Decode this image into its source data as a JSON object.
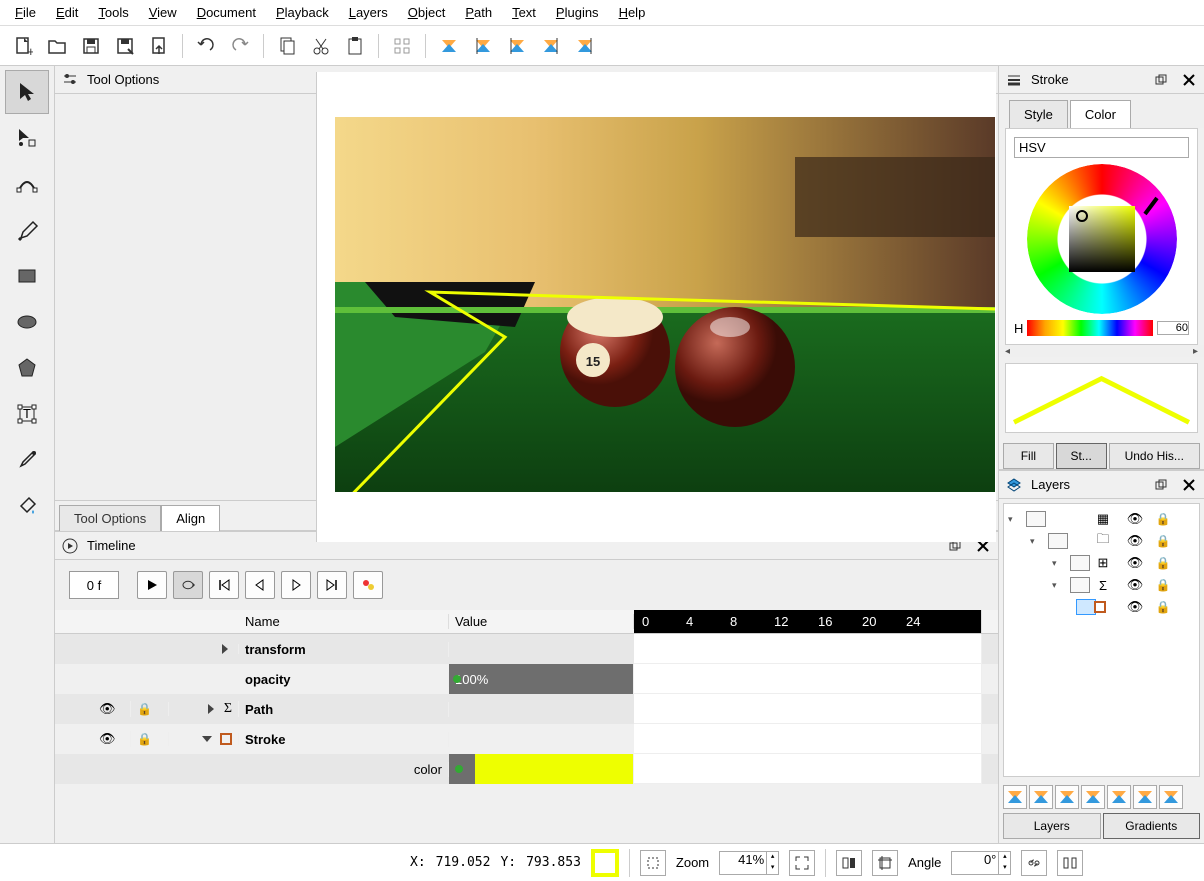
{
  "menu": [
    "File",
    "Edit",
    "Tools",
    "View",
    "Document",
    "Playback",
    "Layers",
    "Object",
    "Path",
    "Text",
    "Plugins",
    "Help"
  ],
  "toolbar_icons": [
    "new-file",
    "open-file",
    "save",
    "save-as",
    "export",
    "sep",
    "undo",
    "redo",
    "sep",
    "copy",
    "cut",
    "paste",
    "sep",
    "qr",
    "sep",
    "keyframe-a",
    "keyframe-b",
    "keyframe-c",
    "keyframe-d",
    "keyframe-e"
  ],
  "toolstrip": [
    "pointer",
    "node-edit",
    "path-tool",
    "brush",
    "rectangle",
    "ellipse",
    "polygon",
    "transform",
    "eyedropper",
    "bucket"
  ],
  "tool_options": {
    "title": "Tool Options",
    "tabs": [
      "Tool Options",
      "Align"
    ],
    "active_tab": 1
  },
  "timeline": {
    "title": "Timeline",
    "frame": "0 f",
    "columns": {
      "name": "Name",
      "value": "Value"
    },
    "ruler": [
      "0",
      "4",
      "8",
      "12",
      "16",
      "20",
      "24"
    ],
    "rows": [
      {
        "name": "transform",
        "bold": true,
        "tri": true
      },
      {
        "name": "opacity",
        "bold": true,
        "value": "100%"
      },
      {
        "name": "Path",
        "bold": true,
        "tri": true,
        "eye": true,
        "lock": true,
        "sigma": true
      },
      {
        "name": "Stroke",
        "bold": true,
        "tri_open": true,
        "eye": true,
        "lock": true,
        "box": "#c05a1e"
      },
      {
        "name": "color",
        "color": "#eeff00"
      }
    ]
  },
  "stroke": {
    "title": "Stroke",
    "tabs": [
      "Style",
      "Color"
    ],
    "active_tab": 1,
    "colorspace": "HSV",
    "hue_label": "H",
    "hue_value": "60",
    "bottom_tabs": [
      "Fill",
      "St...",
      "Undo His..."
    ],
    "active_bottom": 1
  },
  "layers": {
    "title": "Layers",
    "tabs": [
      "Layers",
      "Gradients"
    ],
    "active_tab": 0,
    "icons": [
      "film",
      "folder",
      "grid",
      "sigma",
      "box"
    ],
    "btn_icons": [
      "add-key",
      "onion",
      "del-key",
      "key-up",
      "key-dn",
      "key-left",
      "key-right"
    ]
  },
  "status": {
    "x_label": "X:",
    "x_val": "719.052",
    "y_label": "Y:",
    "y_val": "793.853",
    "zoom_label": "Zoom",
    "zoom_val": "41%",
    "angle_label": "Angle",
    "angle_val": "0°"
  }
}
